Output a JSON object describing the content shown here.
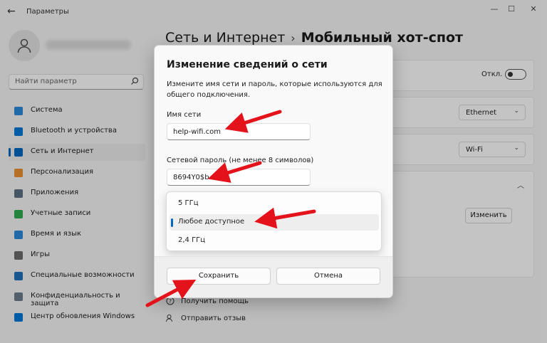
{
  "window": {
    "title": "Параметры",
    "back": "←",
    "controls": [
      "—",
      "☐",
      "✕"
    ]
  },
  "search": {
    "placeholder": "Найти параметр"
  },
  "sidebar": {
    "items": [
      {
        "label": "Система",
        "color": "#2b88d8"
      },
      {
        "label": "Bluetooth и устройства",
        "color": "#0078d4"
      },
      {
        "label": "Сеть и Интернет",
        "color": "#0067c0"
      },
      {
        "label": "Персонализация",
        "color": "#e8912d"
      },
      {
        "label": "Приложения",
        "color": "#5c6f82"
      },
      {
        "label": "Учетные записи",
        "color": "#2fa84f"
      },
      {
        "label": "Время и язык",
        "color": "#2b88d8"
      },
      {
        "label": "Игры",
        "color": "#6b6b6b"
      },
      {
        "label": "Специальные возможности",
        "color": "#1f6fb5"
      },
      {
        "label": "Конфиденциальность и защита",
        "color": "#6b7a8a"
      },
      {
        "label": "Центр обновления Windows",
        "color": "#0078d4"
      }
    ]
  },
  "breadcrumb": {
    "parent": "Сеть и Интернет",
    "separator": "›",
    "current": "Мобильный хот-спот"
  },
  "settings": {
    "toggle_label": "Откл.",
    "share_from": "Ethernet",
    "share_over": "Wi-Fi",
    "change_button": "Изменить"
  },
  "help": {
    "get_help": "Получить помощь",
    "feedback": "Отправить отзыв"
  },
  "dialog": {
    "title": "Изменение сведений о сети",
    "description": "Измените имя сети и пароль, которые используются для общего подключения.",
    "network_name_label": "Имя сети",
    "network_name_value": "help-wifi.com",
    "password_label": "Сетевой пароль (не менее 8 символов)",
    "password_value": "8694Y0$b",
    "band_options": [
      {
        "label": "5 ГГц",
        "selected": false
      },
      {
        "label": "Любое доступное",
        "selected": true
      },
      {
        "label": "2,4 ГГц",
        "selected": false
      }
    ],
    "save_button": "Сохранить",
    "cancel_button": "Отмена"
  },
  "colors": {
    "accent": "#0067c0",
    "annotation_arrow": "#e3121b"
  }
}
